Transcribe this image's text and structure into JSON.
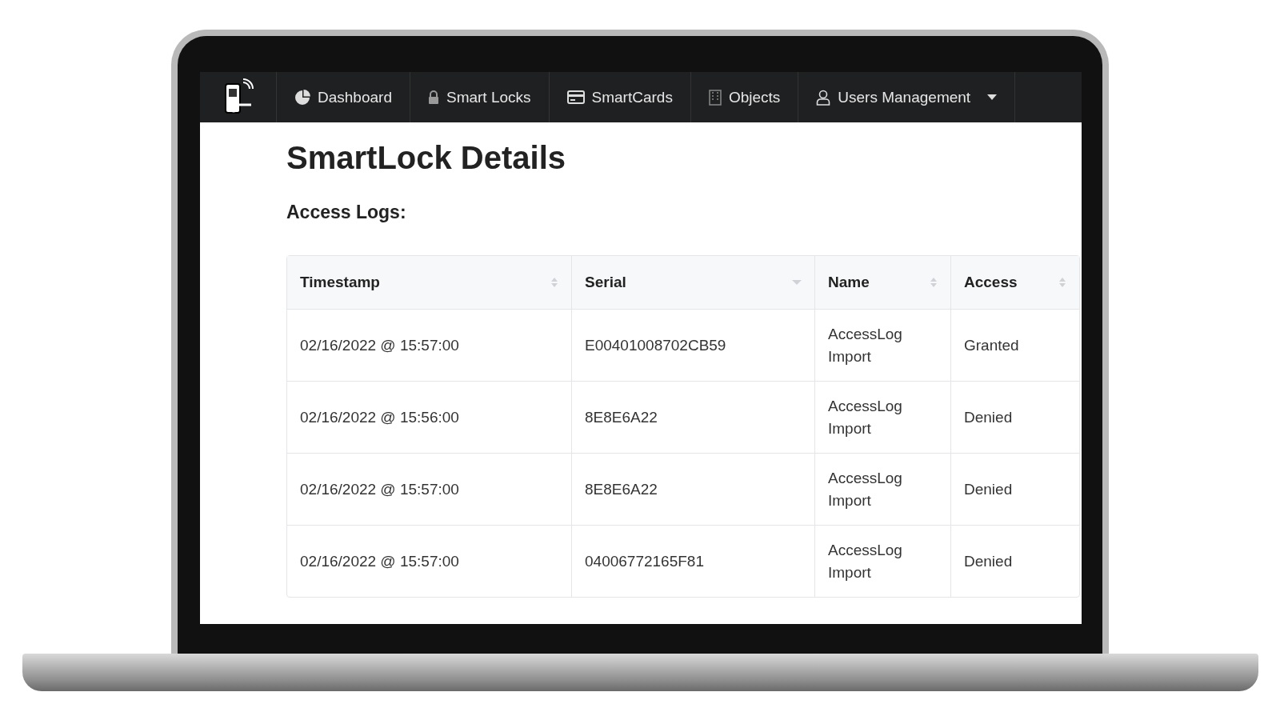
{
  "nav": {
    "items": [
      {
        "label": "Dashboard",
        "dropdown": false
      },
      {
        "label": "Smart Locks",
        "dropdown": false
      },
      {
        "label": "SmartCards",
        "dropdown": false
      },
      {
        "label": "Objects",
        "dropdown": false
      },
      {
        "label": "Users Management",
        "dropdown": true
      }
    ]
  },
  "title": "SmartLock Details",
  "subtitle": "Access Logs:",
  "table": {
    "columns": [
      {
        "label": "Timestamp",
        "sorted": false
      },
      {
        "label": "Serial",
        "sorted": true
      },
      {
        "label": "Name",
        "sorted": false
      },
      {
        "label": "Access",
        "sorted": false
      }
    ],
    "rows": [
      [
        "02/16/2022 @ 15:57:00",
        "E00401008702CB59",
        "AccessLog Import",
        "Granted"
      ],
      [
        "02/16/2022 @ 15:56:00",
        "8E8E6A22",
        "AccessLog Import",
        "Denied"
      ],
      [
        "02/16/2022 @ 15:57:00",
        "8E8E6A22",
        "AccessLog Import",
        "Denied"
      ],
      [
        "02/16/2022 @ 15:57:00",
        "04006772165F81",
        "AccessLog Import",
        "Denied"
      ]
    ]
  }
}
